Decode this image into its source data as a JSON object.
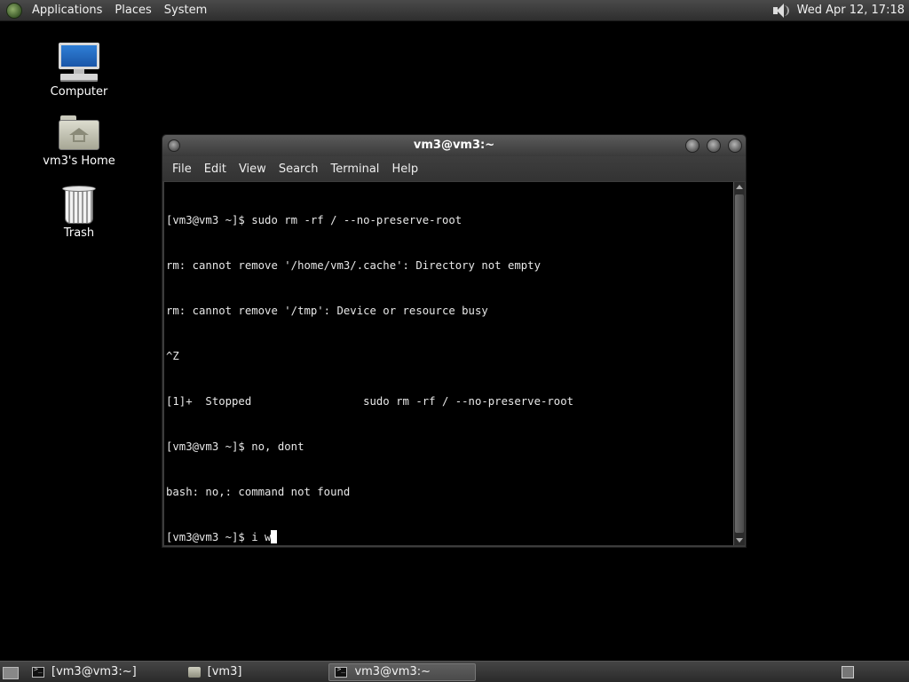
{
  "top_panel": {
    "menus": [
      "Applications",
      "Places",
      "System"
    ],
    "clock": "Wed Apr 12, 17:18"
  },
  "desktop_icons": [
    {
      "label": "Computer",
      "icon": "computer-icon"
    },
    {
      "label": "vm3's Home",
      "icon": "home-folder-icon"
    },
    {
      "label": "Trash",
      "icon": "trash-icon"
    }
  ],
  "terminal": {
    "title": "vm3@vm3:~",
    "menu": [
      "File",
      "Edit",
      "View",
      "Search",
      "Terminal",
      "Help"
    ],
    "lines": [
      "[vm3@vm3 ~]$ sudo rm -rf / --no-preserve-root",
      "rm: cannot remove '/home/vm3/.cache': Directory not empty",
      "rm: cannot remove '/tmp': Device or resource busy",
      "^Z",
      "[1]+  Stopped                 sudo rm -rf / --no-preserve-root",
      "[vm3@vm3 ~]$ no, dont",
      "bash: no,: command not found"
    ],
    "prompt_line": "[vm3@vm3 ~]$ i w"
  },
  "taskbar": {
    "tasks": [
      {
        "label": "[vm3@vm3:~]",
        "icon": "terminal-icon",
        "active": false
      },
      {
        "label": "[vm3]",
        "icon": "folder-icon",
        "active": false
      },
      {
        "label": "vm3@vm3:~",
        "icon": "terminal-icon",
        "active": true
      }
    ]
  }
}
